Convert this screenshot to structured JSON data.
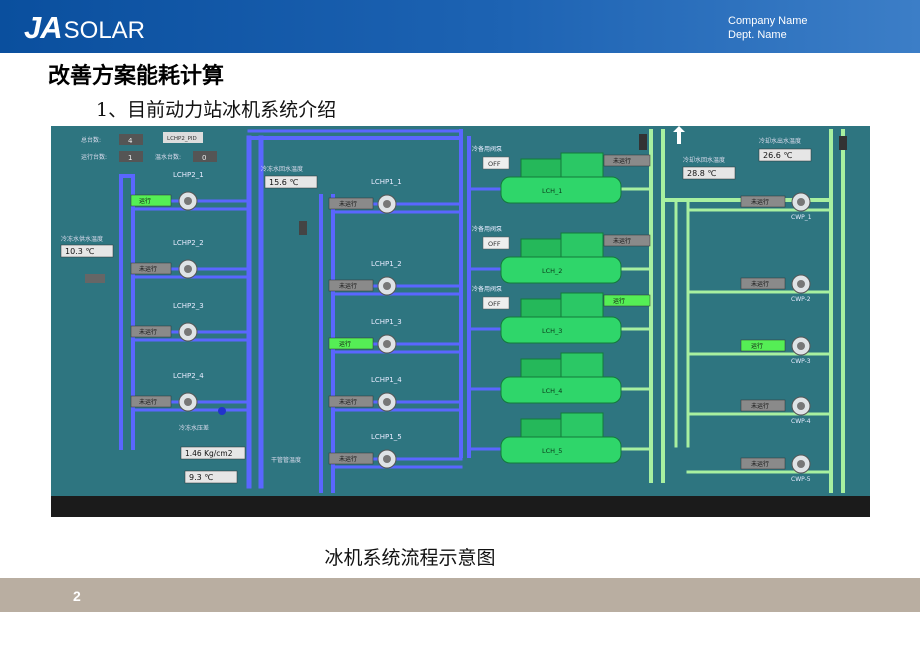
{
  "header": {
    "logo_ja": "JA",
    "logo_solar": "SOLAR",
    "company_name": "Company Name",
    "dept_name": "Dept. Name"
  },
  "title": "改善方案能耗计算",
  "subtitle": "1、目前动力站冰机系统介绍",
  "caption": "冰机系统流程示意图",
  "page_number": "2",
  "scada": {
    "top_left": {
      "total_label": "总台数:",
      "total_value": "4",
      "running_label": "运行台数:",
      "running_value": "1",
      "standby_label": "温水台数:",
      "standby_value": "0",
      "tag": "LCHP2_PID"
    },
    "temps": {
      "cold_return_label": "冷冻水回水温度",
      "cold_return_value": "15.6 ℃",
      "cold_supply_label": "冷冻水供水温度",
      "cold_supply_value": "10.3 ℃",
      "cooling_out_label": "冷却水出水温度",
      "cooling_out_value": "26.6 ℃",
      "cooling_in_label": "冷却水回水温度",
      "cooling_in_value": "28.8 ℃",
      "pressure_label": "冷冻水压差",
      "pressure_value": "1.46 Kg/cm2",
      "bottom_value": "9.3 ℃",
      "dry_pipe_label": "干管管温度"
    },
    "pumps_left": [
      {
        "name": "LCHP2_1",
        "status": "运行",
        "running": true
      },
      {
        "name": "LCHP2_2",
        "status": "未运行",
        "running": false
      },
      {
        "name": "LCHP2_3",
        "status": "未运行",
        "running": false
      },
      {
        "name": "LCHP2_4",
        "status": "未运行",
        "running": false
      }
    ],
    "pumps_mid": [
      {
        "name": "LCHP1_1",
        "status": "未运行",
        "running": false
      },
      {
        "name": "LCHP1_2",
        "status": "未运行",
        "running": false
      },
      {
        "name": "LCHP1_3",
        "status": "运行",
        "running": true
      },
      {
        "name": "LCHP1_4",
        "status": "未运行",
        "running": false
      },
      {
        "name": "LCHP1_5",
        "status": "未运行",
        "running": false
      }
    ],
    "chillers": [
      {
        "name": "LCH_1",
        "status": "未运行",
        "running": false,
        "valve_label": "冷备用阀泵",
        "valve": "OFF"
      },
      {
        "name": "LCH_2",
        "status": "未运行",
        "running": false,
        "valve_label": "冷备用阀泵",
        "valve": "OFF"
      },
      {
        "name": "LCH_3",
        "status": "运行",
        "running": true,
        "valve_label": "冷备用阀泵",
        "valve": "OFF"
      },
      {
        "name": "LCH_4",
        "status": "",
        "running": false,
        "valve_label": "",
        "valve": ""
      },
      {
        "name": "LCH_5",
        "status": "",
        "running": false,
        "valve_label": "",
        "valve": ""
      }
    ],
    "pumps_right": [
      {
        "name": "CWP_1",
        "status": "未运行",
        "running": false
      },
      {
        "name": "CWP-2",
        "status": "未运行",
        "running": false
      },
      {
        "name": "CWP-3",
        "status": "运行",
        "running": true
      },
      {
        "name": "CWP-4",
        "status": "未运行",
        "running": false
      },
      {
        "name": "CWP-5",
        "status": "未运行",
        "running": false
      }
    ],
    "colors": {
      "background": "#2e7580",
      "chilled_pipe": "#5a66ff",
      "cooling_pipe": "#a8f0a0",
      "chiller_green": "#2fd66a",
      "running_green": "#55ee55",
      "stopped_gray": "#8a8a8a"
    }
  }
}
